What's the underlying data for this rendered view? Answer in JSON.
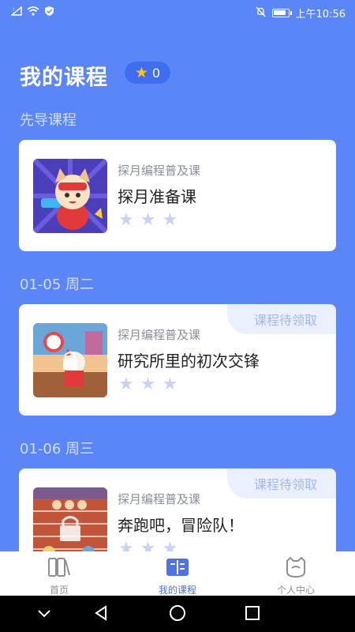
{
  "status_bar": {
    "time": "上午10:56"
  },
  "header": {
    "title": "我的课程",
    "star_count": "0"
  },
  "sections": [
    {
      "label": "先导课程"
    },
    {
      "label": "01-05 周二"
    },
    {
      "label": "01-06 周三"
    }
  ],
  "courses": [
    {
      "subtitle": "探月编程普及课",
      "title": "探月准备课",
      "tag": ""
    },
    {
      "subtitle": "探月编程普及课",
      "title": "研究所里的初次交锋",
      "tag": "课程待领取"
    },
    {
      "subtitle": "探月编程普及课",
      "title": "奔跑吧，冒险队！",
      "tag": "课程待领取"
    }
  ],
  "nav": {
    "home": "首页",
    "my_courses": "我的课程",
    "profile": "个人中心"
  },
  "colors": {
    "background": "#5a86f8",
    "accent": "#4f73e6",
    "star": "#ffc21a"
  }
}
